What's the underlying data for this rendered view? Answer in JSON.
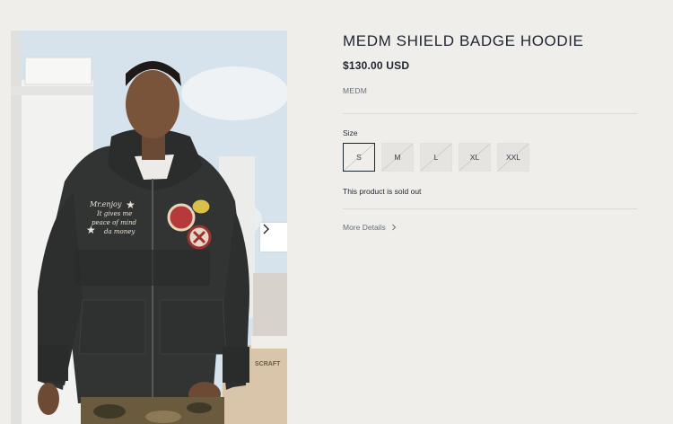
{
  "product": {
    "title": "MEDM SHIELD BADGE HOODIE",
    "price": "$130.00 USD",
    "vendor": "MEDM",
    "size_label": "Size",
    "sizes": [
      {
        "label": "S",
        "selected": true,
        "available": false
      },
      {
        "label": "M",
        "selected": false,
        "available": false
      },
      {
        "label": "L",
        "selected": false,
        "available": false
      },
      {
        "label": "XL",
        "selected": false,
        "available": false
      },
      {
        "label": "XXL",
        "selected": false,
        "available": false
      }
    ],
    "availability": "This product is sold out",
    "more_details": "More Details"
  },
  "gallery": {
    "next_icon": "chevron-right-icon",
    "image_text": {
      "patch_script": [
        "Mr.enjoy",
        "It gives me",
        "peace of mind",
        "da money"
      ],
      "shirt_sign": "SCRAFT"
    }
  },
  "colors": {
    "background": "#efeeeb",
    "text": "#1f2530",
    "muted": "#6a6f78",
    "size_box": "#e6e4e0"
  }
}
